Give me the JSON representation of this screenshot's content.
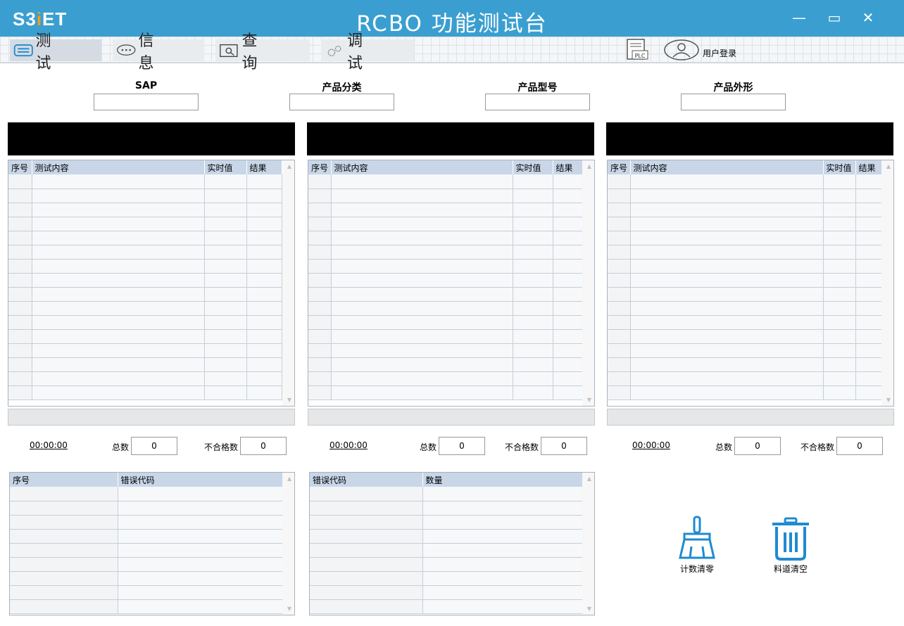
{
  "app": {
    "logo_main": "S3",
    "logo_dot": "i",
    "logo_tail": "ET",
    "title": "RCBO 功能测试台",
    "controls": {
      "minimize": "—",
      "maximize": "▭",
      "close": "✕"
    }
  },
  "nav": {
    "tabs": [
      {
        "label": "测试",
        "icon": "test-icon",
        "active": true
      },
      {
        "label": "信息",
        "icon": "chat-icon",
        "active": false
      },
      {
        "label": "查询",
        "icon": "query-icon",
        "active": false
      },
      {
        "label": "调试",
        "icon": "gears-icon",
        "active": false
      }
    ],
    "plc_label": "PLC",
    "login_label": "用户登录"
  },
  "fields": [
    {
      "label": "SAP",
      "value": ""
    },
    {
      "label": "产品分类",
      "value": ""
    },
    {
      "label": "产品型号",
      "value": ""
    },
    {
      "label": "产品外形",
      "value": ""
    }
  ],
  "stations": [
    {
      "columns": [
        "序号",
        "测试内容",
        "实时值",
        "结果"
      ],
      "timer": "00:00:00",
      "total_label": "总数",
      "total": "0",
      "fail_label": "不合格数",
      "fail": "0"
    },
    {
      "columns": [
        "序号",
        "测试内容",
        "实时值",
        "结果"
      ],
      "timer": "00:00:00",
      "total_label": "总数",
      "total": "0",
      "fail_label": "不合格数",
      "fail": "0"
    },
    {
      "columns": [
        "序号",
        "测试内容",
        "实时值",
        "结果"
      ],
      "timer": "00:00:00",
      "total_label": "总数",
      "total": "0",
      "fail_label": "不合格数",
      "fail": "0"
    }
  ],
  "error_list": {
    "columns": [
      "序号",
      "错误代码"
    ]
  },
  "error_count": {
    "columns": [
      "错误代码",
      "数量"
    ]
  },
  "actions": {
    "reset_count": {
      "label": "计数清零",
      "icon": "broom-icon"
    },
    "clear_channel": {
      "label": "料道清空",
      "icon": "trash-icon"
    }
  },
  "colors": {
    "titlebar": "#3a9fd0",
    "header": "#c8d6e8",
    "accent": "#1f8ad1"
  }
}
